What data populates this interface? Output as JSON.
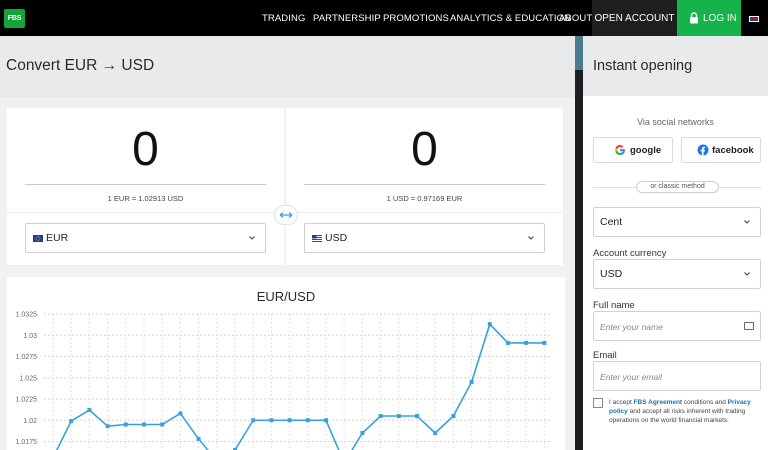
{
  "nav": {
    "logo": "FBS",
    "items": [
      "TRADING",
      "PARTNERSHIP",
      "PROMOTIONS",
      "ANALYTICS & EDUCATION",
      "ABOUT"
    ],
    "open_account": "OPEN ACCOUNT",
    "login": "LOG IN",
    "language_icon": "uk-flag-icon"
  },
  "converter": {
    "title": "Convert EUR → USD",
    "from": {
      "value": "0",
      "rate": "1 EUR = 1.02913 USD",
      "currency": "EUR"
    },
    "to": {
      "value": "0",
      "rate": "1 USD = 0.97169 EUR",
      "currency": "USD"
    }
  },
  "chart_data": {
    "type": "line",
    "title": "EUR/USD",
    "xlabel": "",
    "ylabel": "",
    "ylim": [
      1.0165,
      1.0325
    ],
    "y_ticks": [
      "1.0325",
      "1.03",
      "1.0275",
      "1.025",
      "1.0225",
      "1.02",
      "1.0175"
    ],
    "color": "#3aa0dc",
    "grid": true,
    "series": [
      {
        "values": [
          1.0156,
          1.0199,
          1.0212,
          1.0193,
          1.0195,
          1.0195,
          1.0195,
          1.0208,
          1.0178,
          1.0152,
          1.0165,
          1.02,
          1.02,
          1.02,
          1.02,
          1.02,
          1.015,
          1.0185,
          1.0205,
          1.0205,
          1.0205,
          1.0185,
          1.0205,
          1.0245,
          1.0313,
          1.0291,
          1.0291,
          1.0291
        ]
      }
    ]
  },
  "signup": {
    "title": "Instant opening",
    "social_label": "Via social networks",
    "google": "google",
    "facebook": "facebook",
    "or_label": "or classic method",
    "account_type": "Cent",
    "currency_label": "Account currency",
    "currency": "USD",
    "fullname_label": "Full name",
    "fullname_placeholder": "Enter your name",
    "email_label": "Email",
    "email_placeholder": "Enter your email",
    "agree_1": "I accept",
    "agree_link1": "FBS Agreement",
    "agree_2": "conditions and",
    "agree_link2": "Privacy policy",
    "agree_3": "and accept all risks inherent with trading operations on the world financial markets."
  }
}
